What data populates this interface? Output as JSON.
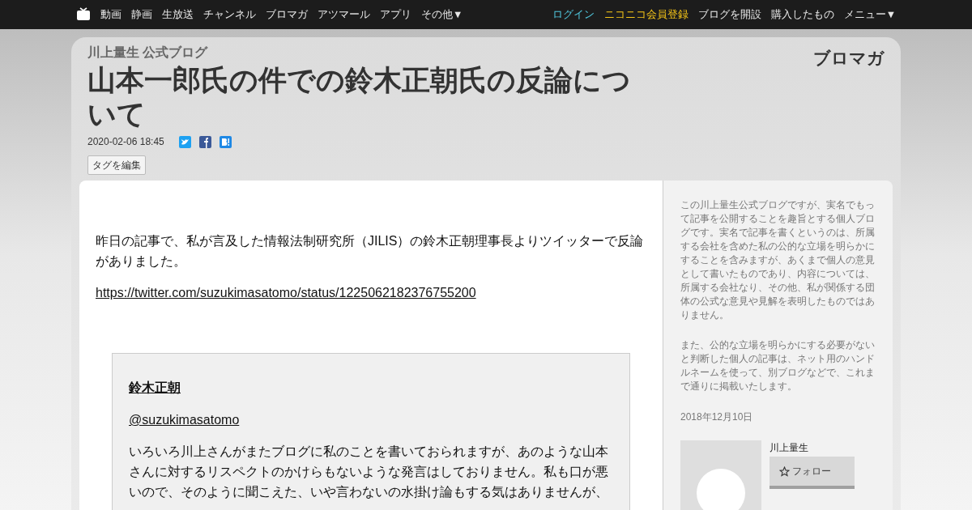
{
  "top_nav": {
    "left_items": [
      "動画",
      "静画",
      "生放送",
      "チャンネル",
      "ブロマガ",
      "アツマール",
      "アプリ",
      "その他▼"
    ],
    "right_items": [
      {
        "label": "ログイン",
        "kind": "login"
      },
      {
        "label": "ニコニコ会員登録",
        "kind": "register"
      },
      {
        "label": "ブログを開設",
        "kind": "plain"
      },
      {
        "label": "購入したもの",
        "kind": "plain"
      },
      {
        "label": "メニュー▼",
        "kind": "plain"
      }
    ]
  },
  "header": {
    "blog_name": "川上量生 公式ブログ",
    "title": "山本一郎氏の件での鈴木正朝氏の反論について",
    "date": "2020-02-06 18:45",
    "logo": "ブロマガ",
    "tag_button": "タグを編集"
  },
  "article": {
    "paragraph": "昨日の記事で、私が言及した情報法制研究所（JILIS）の鈴木正朝理事長よりツイッターで反論がありました。",
    "link": "https://twitter.com/suzukimasatomo/status/1225062182376755200",
    "quote": {
      "name": "鈴木正朝",
      "handle": "@suzukimasatomo",
      "text": "いろいろ川上さんがまたブログに私のことを書いておられますが、あのような山本さんに対するリスペクトのかけらもないような発言はしておりません。私も口が悪いので、そのように聞こえた、いや言わないの水掛け論もする気はありませんが、"
    }
  },
  "sidebar": {
    "paragraphs": [
      "この川上量生公式ブログですが、実名でもって記事を公開することを趣旨とする個人ブログです。実名で記事を書くというのは、所属する会社を含めた私の公的な立場を明らかにすることを含みますが、あくまで個人の意見として書いたものであり、内容については、所属する会社なり、その他、私が関係する団体の公式な意見や見解を表明したものではありません。",
      "また、公的な立場を明らかにする必要がないと判断した個人の記事は、ネット用のハンドルネームを使って、別ブログなどで、これまで通りに掲載いたします。"
    ],
    "date": "2018年12月10日",
    "author": "川上量生",
    "follow_button": "フォロー"
  }
}
